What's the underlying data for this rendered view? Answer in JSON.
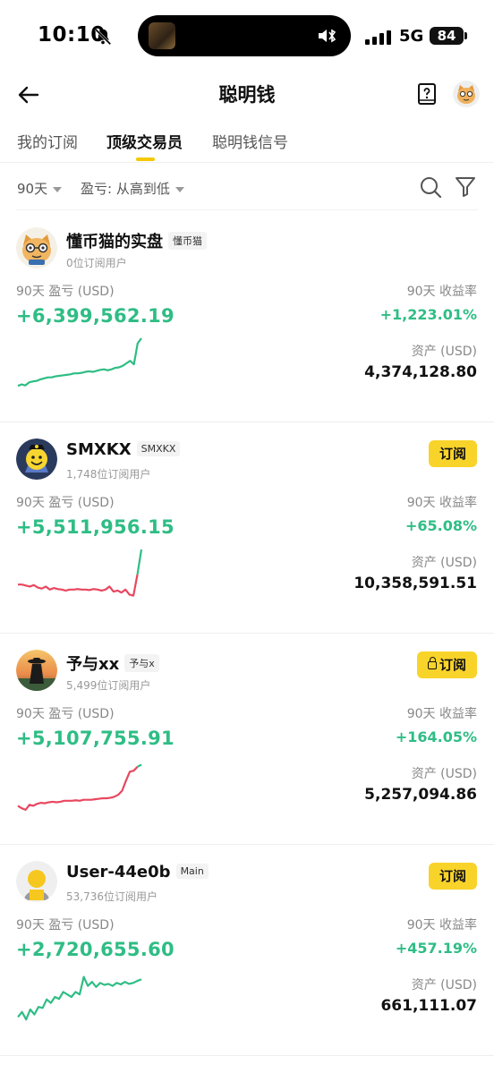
{
  "status_bar": {
    "time": "10:10",
    "network": "5G",
    "battery": "84"
  },
  "header": {
    "title": "聪明钱"
  },
  "tabs": [
    {
      "label": "我的订阅",
      "active": false
    },
    {
      "label": "顶级交易员",
      "active": true
    },
    {
      "label": "聪明钱信号",
      "active": false
    }
  ],
  "filters": {
    "period": "90天",
    "sort": "盈亏: 从高到低"
  },
  "traders": [
    {
      "name": "懂币猫的实盘",
      "tag": "懂币猫",
      "subscribers": "0位订阅用户",
      "subscribe_label": "",
      "pnl_label": "90天 盈亏 (USD)",
      "pnl": "+6,399,562.19",
      "roi_label": "90天 收益率",
      "roi": "+1,223.01%",
      "assets_label": "资产 (USD)",
      "assets": "4,374,128.80",
      "sparkline": [
        0.05,
        0.08,
        0.06,
        0.12,
        0.14,
        0.15,
        0.18,
        0.2,
        0.22,
        0.22,
        0.24,
        0.25,
        0.26,
        0.27,
        0.28,
        0.3,
        0.3,
        0.31,
        0.33,
        0.34,
        0.33,
        0.35,
        0.37,
        0.38,
        0.36,
        0.38,
        0.41,
        0.42,
        0.45,
        0.5,
        0.55,
        0.48,
        0.9,
        1.0
      ],
      "sparkline_colors": [
        "#2fbd85"
      ]
    },
    {
      "name": "SMXKX",
      "tag": "SMXKX",
      "subscribers": "1,748位订阅用户",
      "subscribe_label": "订阅",
      "pnl_label": "90天 盈亏 (USD)",
      "pnl": "+5,511,956.15",
      "roi_label": "90天 收益率",
      "roi": "+65.08%",
      "assets_label": "资产 (USD)",
      "assets": "10,358,591.51",
      "sparkline": [
        0.3,
        0.3,
        0.28,
        0.26,
        0.29,
        0.24,
        0.22,
        0.26,
        0.2,
        0.23,
        0.21,
        0.2,
        0.18,
        0.2,
        0.2,
        0.21,
        0.2,
        0.2,
        0.19,
        0.21,
        0.2,
        0.18,
        0.2,
        0.26,
        0.16,
        0.18,
        0.14,
        0.2,
        0.1,
        0.08,
        0.5,
        1.0
      ],
      "sparkline_colors": [
        "#e8475f",
        "#2fbd85"
      ]
    },
    {
      "name": "予与xx",
      "tag": "予与x",
      "subscribers": "5,499位订阅用户",
      "subscribe_label": "订阅",
      "locked": true,
      "pnl_label": "90天 盈亏 (USD)",
      "pnl": "+5,107,755.91",
      "roi_label": "90天 收益率",
      "roi": "+164.05%",
      "assets_label": "资产 (USD)",
      "assets": "5,257,094.86",
      "sparkline": [
        0.1,
        0.05,
        0.02,
        0.12,
        0.1,
        0.14,
        0.16,
        0.15,
        0.17,
        0.18,
        0.17,
        0.18,
        0.2,
        0.2,
        0.2,
        0.21,
        0.2,
        0.22,
        0.22,
        0.22,
        0.23,
        0.24,
        0.25,
        0.25,
        0.26,
        0.28,
        0.32,
        0.4,
        0.6,
        0.78,
        0.8,
        0.88,
        0.92
      ],
      "sparkline_colors": [
        "#e8475f",
        "#2fbd85"
      ]
    },
    {
      "name": "User-44e0b",
      "tag": "Main",
      "subscribers": "53,736位订阅用户",
      "subscribe_label": "订阅",
      "pnl_label": "90天 盈亏 (USD)",
      "pnl": "+2,720,655.60",
      "roi_label": "90天 收益率",
      "roi": "+457.19%",
      "assets_label": "资产 (USD)",
      "assets": "661,111.07",
      "sparkline": [
        0.1,
        0.2,
        0.05,
        0.25,
        0.15,
        0.3,
        0.28,
        0.45,
        0.38,
        0.5,
        0.46,
        0.6,
        0.55,
        0.5,
        0.6,
        0.55,
        0.9,
        0.72,
        0.8,
        0.7,
        0.78,
        0.74,
        0.76,
        0.72,
        0.78,
        0.75,
        0.8,
        0.76,
        0.78,
        0.82,
        0.85
      ],
      "sparkline_colors": [
        "#2fbd85"
      ]
    }
  ]
}
